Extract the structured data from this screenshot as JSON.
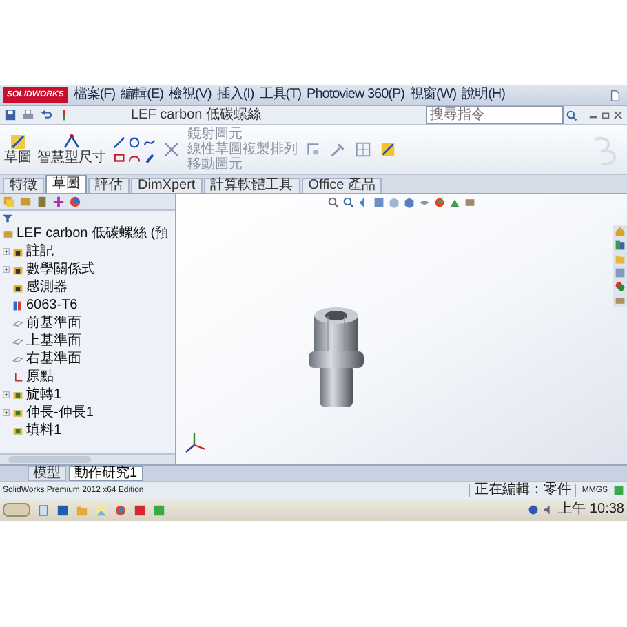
{
  "app": {
    "logo": "SOLIDWORKS",
    "menus": [
      "檔案(F)",
      "編輯(E)",
      "檢視(V)",
      "插入(I)",
      "工具(T)",
      "Photoview 360(P)",
      "視窗(W)",
      "說明(H)"
    ],
    "document_title": "LEF carbon 低碳螺絲",
    "search": {
      "placeholder": "搜尋指令"
    }
  },
  "command_manager": {
    "tools": [
      {
        "label": "草圖"
      },
      {
        "label": "智慧型尺寸"
      }
    ],
    "list_tools": [
      "鏡射圖元",
      "線性草圖複製排列",
      "移動圖元"
    ]
  },
  "tabs": [
    {
      "label": "特徵",
      "selected": false
    },
    {
      "label": "草圖",
      "selected": true
    },
    {
      "label": "評估",
      "selected": false
    },
    {
      "label": "DimXpert",
      "selected": false
    },
    {
      "label": "計算軟體工具",
      "selected": false
    },
    {
      "label": "Office 產品",
      "selected": false
    }
  ],
  "feature_tree": {
    "root": "LEF carbon 低碳螺絲 (預",
    "items": [
      {
        "label": "註記",
        "kind": "folder",
        "collapsed": true
      },
      {
        "label": "數學關係式",
        "kind": "folder",
        "collapsed": true
      },
      {
        "label": "感測器",
        "kind": "folder",
        "collapsed": false
      },
      {
        "label": "6063-T6",
        "kind": "material",
        "collapsed": false
      },
      {
        "label": "前基準面",
        "kind": "plane",
        "collapsed": false
      },
      {
        "label": "上基準面",
        "kind": "plane",
        "collapsed": false
      },
      {
        "label": "右基準面",
        "kind": "plane",
        "collapsed": false
      },
      {
        "label": "原點",
        "kind": "origin",
        "collapsed": false
      },
      {
        "label": "旋轉1",
        "kind": "feature",
        "collapsed": true
      },
      {
        "label": "伸長-伸長1",
        "kind": "feature",
        "collapsed": true
      },
      {
        "label": "填料1",
        "kind": "feature",
        "collapsed": false
      }
    ]
  },
  "bottom_tabs": [
    {
      "label": "模型",
      "selected": false
    },
    {
      "label": "動作研究1",
      "selected": true
    }
  ],
  "status_bar": {
    "product": "SolidWorks Premium 2012 x64 Edition",
    "editing": "正在編輯：零件",
    "units": "MMGS"
  },
  "taskbar": {
    "clock": "上午 10:38"
  }
}
